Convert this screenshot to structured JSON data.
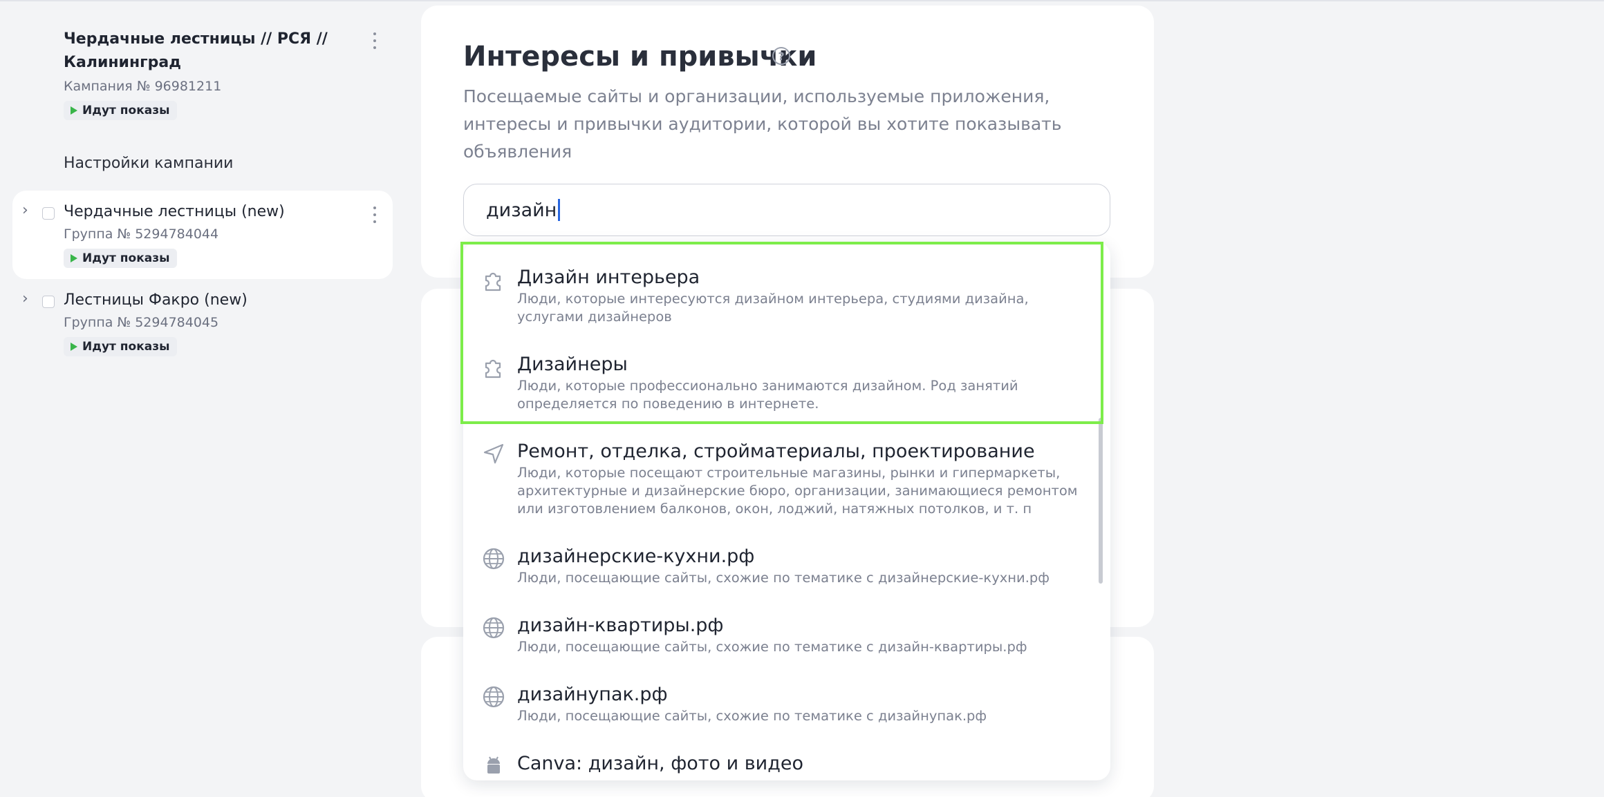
{
  "sidebar": {
    "campaign": {
      "title": "Чердачные лестницы // РСЯ // Калининград",
      "number": "Кампания № 96981211",
      "status": "Идут показы"
    },
    "settings_link": "Настройки кампании",
    "groups": [
      {
        "name": "Чердачные лестницы (new)",
        "number": "Группа № 5294784044",
        "status": "Идут показы",
        "active": true
      },
      {
        "name": "Лестницы Факро (new)",
        "number": "Группа № 5294784045",
        "status": "Идут показы",
        "active": false
      }
    ]
  },
  "main": {
    "title": "Интересы и привычки",
    "help_icon": "?",
    "description": "Посещаемые сайты и организации, используемые приложения, интересы и привычки аудитории, которой вы хотите показывать объявления",
    "search": {
      "value": "дизайн"
    }
  },
  "dropdown": {
    "items": [
      {
        "icon": "puzzle-icon",
        "title": "Дизайн интерьера",
        "subtitle": "Люди, которые интересуются дизайном интерьера, студиями дизайна, услугами дизайнеров"
      },
      {
        "icon": "puzzle-icon",
        "title": "Дизайнеры",
        "subtitle": "Люди, которые профессионально занимаются дизайном. Род занятий определяется по поведению в интернете."
      },
      {
        "icon": "location-arrow-icon",
        "title": "Ремонт, отделка, стройматериалы, проектирование",
        "subtitle": "Люди, которые посещают строительные магазины, рынки и гипермаркеты, архитектурные и дизайнерские бюро, организации, занимающиеся ремонтом или изготовлением балконов, окон, лоджий, натяжных потолков, и т. п"
      },
      {
        "icon": "globe-icon",
        "title": "дизайнерские-кухни.рф",
        "subtitle": "Люди, посещающие сайты, схожие по тематике с дизайнерские-кухни.рф"
      },
      {
        "icon": "globe-icon",
        "title": "дизайн-квартиры.рф",
        "subtitle": "Люди, посещающие сайты, схожие по тематике с дизайн-квартиры.рф"
      },
      {
        "icon": "globe-icon",
        "title": "дизайнупак.рф",
        "subtitle": "Люди, посещающие сайты, схожие по тематике с дизайнупак.рф"
      },
      {
        "icon": "android-icon",
        "title": "Canva: дизайн, фото и видео",
        "subtitle": ""
      }
    ]
  },
  "colors": {
    "highlight": "#7ded4a",
    "status_play": "#39b54a",
    "caret": "#2866e0"
  }
}
